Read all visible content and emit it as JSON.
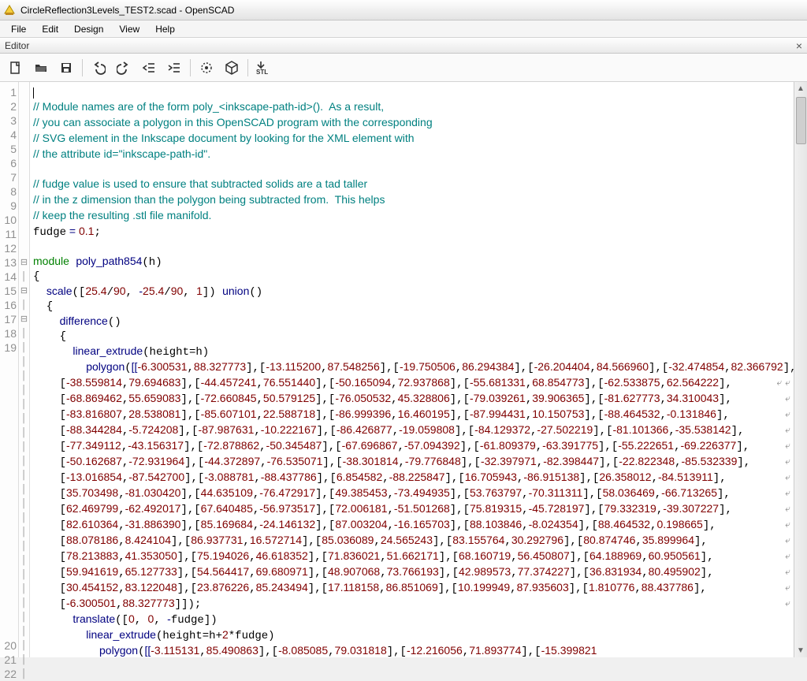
{
  "window": {
    "title": "CircleReflection3Levels_TEST2.scad - OpenSCAD"
  },
  "menus": {
    "file": "File",
    "edit": "Edit",
    "design": "Design",
    "view": "View",
    "help": "Help"
  },
  "panel": {
    "editor_label": "Editor"
  },
  "toolbar_icons": [
    "new-file",
    "open-file",
    "save-file",
    "undo",
    "redo",
    "unindent",
    "indent",
    "preview-render",
    "render",
    "export-stl"
  ],
  "code": {
    "line1": "",
    "line2": "// Module names are of the form poly_<inkscape-path-id>().  As a result,",
    "line3": "// you can associate a polygon in this OpenSCAD program with the corresponding",
    "line4": "// SVG element in the Inkscape document by looking for the XML element with",
    "line5": "// the attribute id=\"inkscape-path-id\".",
    "line6": "",
    "line7": "// fudge value is used to ensure that subtracted solids are a tad taller",
    "line8": "// in the z dimension than the polygon being subtracted from.  This helps",
    "line9": "// keep the resulting .stl file manifold.",
    "line10_kw": "fudge",
    "line10_rest": " = ",
    "line10_num": "0.1",
    "line10_semi": ";",
    "line12_kw": "module",
    "line12_fn": "poly_path854",
    "line12_args": "(h)",
    "line13": "{",
    "line14_indent": "  ",
    "line14_fn": "scale",
    "line14_args_open": "([",
    "line14_n1": "25.4",
    "line14_s1": "/",
    "line14_n2": "90",
    "line14_c1": ", ",
    "line14_neg": "-",
    "line14_n3": "25.4",
    "line14_s2": "/",
    "line14_n4": "90",
    "line14_c2": ", ",
    "line14_n5": "1",
    "line14_args_close": "]) ",
    "line14_union": "union",
    "line14_p": "()",
    "line15": "  {",
    "line16_indent": "    ",
    "line16_fn": "difference",
    "line16_p": "()",
    "line17": "    {",
    "line18_indent": "      ",
    "line18_fn": "linear_extrude",
    "line18_args": "(height=h)",
    "line19_indent": "        ",
    "line19_fn": "polygon",
    "line19_open": "([[",
    "poly1": "-6.300531,88.327773],[-13.115200,87.548256],[-19.750506,86.294384],[-26.204404,84.566960],[-32.474854,82.366792],[-38.559814,79.694683],[-44.457241,76.551440],[-50.165094,72.937868],[-55.681331,68.854773],[-62.533875,62.564222],[-68.869462,55.659083],[-72.660845,50.579125],[-76.050532,45.328806],[-79.039261,39.906365],[-81.627773,34.310043],[-83.816807,28.538081],[-85.607101,22.588718],[-86.999396,16.460195],[-87.994431,10.150753],[-88.464532,-0.131846],[-88.344284,-5.724208],[-87.987631,-10.222167],[-86.426877,-19.059808],[-84.129372,-27.502219],[-81.101366,-35.538142],[-77.349112,-43.156317],[-72.878862,-50.345487],[-67.696867,-57.094392],[-61.809379,-63.391775],[-55.222651,-69.226377],[-50.162687,-72.931964],[-44.372897,-76.535071],[-38.301814,-79.776848],[-32.397971,-82.398447],[-22.822348,-85.532339],[-13.016854,-87.542700],[-3.088781,-88.437786],[6.854582,-88.225847],[16.705943,-86.915138],[26.358012,-84.513911],[35.703498,-81.030420],[44.635109,-76.472917],[49.385453,-73.494935],[53.763797,-70.311311],[58.036469,-66.713265],[62.469799,-62.492017],[67.640485,-56.973517],[72.006181,-51.501268],[75.819315,-45.728197],[79.332319,-39.307227],[82.610364,-31.886390],[85.169684,-24.146132],[87.003204,-16.165703],[88.103846,-8.024354],[88.464532,0.198665],[88.078186,8.424104],[86.937731,16.572714],[85.036089,24.565243],[83.155764,30.292796],[80.874746,35.899964],[78.213883,41.353050],[75.194026,46.618352],[71.836021,51.662171],[68.160719,56.450807],[64.188969,60.950561],[59.941619,65.127733],[54.564417,69.680971],[48.907068,73.766193],[42.989573,77.374227],[36.831934,80.495902],[30.454152,83.122048],[23.876226,85.243494],[17.118158,86.851069],[10.199949,87.935603],[1.810776,88.437786],[-6.300501,88.327773]]);",
    "line20_indent": "      ",
    "line20_fn": "translate",
    "line20_args_open": "([",
    "line20_n1": "0",
    "line20_c1": ", ",
    "line20_n2": "0",
    "line20_c2": ", ",
    "line20_neg": "-",
    "line20_var": "fudge",
    "line20_close": "])",
    "line21_indent": "        ",
    "line21_fn": "linear_extrude",
    "line21_args": "(height=h+",
    "line21_n": "2",
    "line21_rest": "*fudge)",
    "line22_indent": "          ",
    "line22_fn": "polygon",
    "line22_open": "([[",
    "line22_data": "-3.115131,85.490863],[-8.085085,79.031818],[-12.216056,71.893774],[-15.399821"
  },
  "gutter": [
    "1",
    "2",
    "3",
    "4",
    "5",
    "6",
    "7",
    "8",
    "9",
    "10",
    "11",
    "12",
    "13",
    "14",
    "15",
    "16",
    "17",
    "18",
    "19",
    "",
    "",
    "",
    "",
    "",
    "",
    "",
    "",
    "",
    "",
    "",
    "",
    "",
    "",
    "",
    "",
    "",
    "",
    "",
    "",
    "20",
    "21",
    "22"
  ],
  "fold": {
    "l13": "⊟",
    "l15": "⊟",
    "l17": "⊟"
  }
}
